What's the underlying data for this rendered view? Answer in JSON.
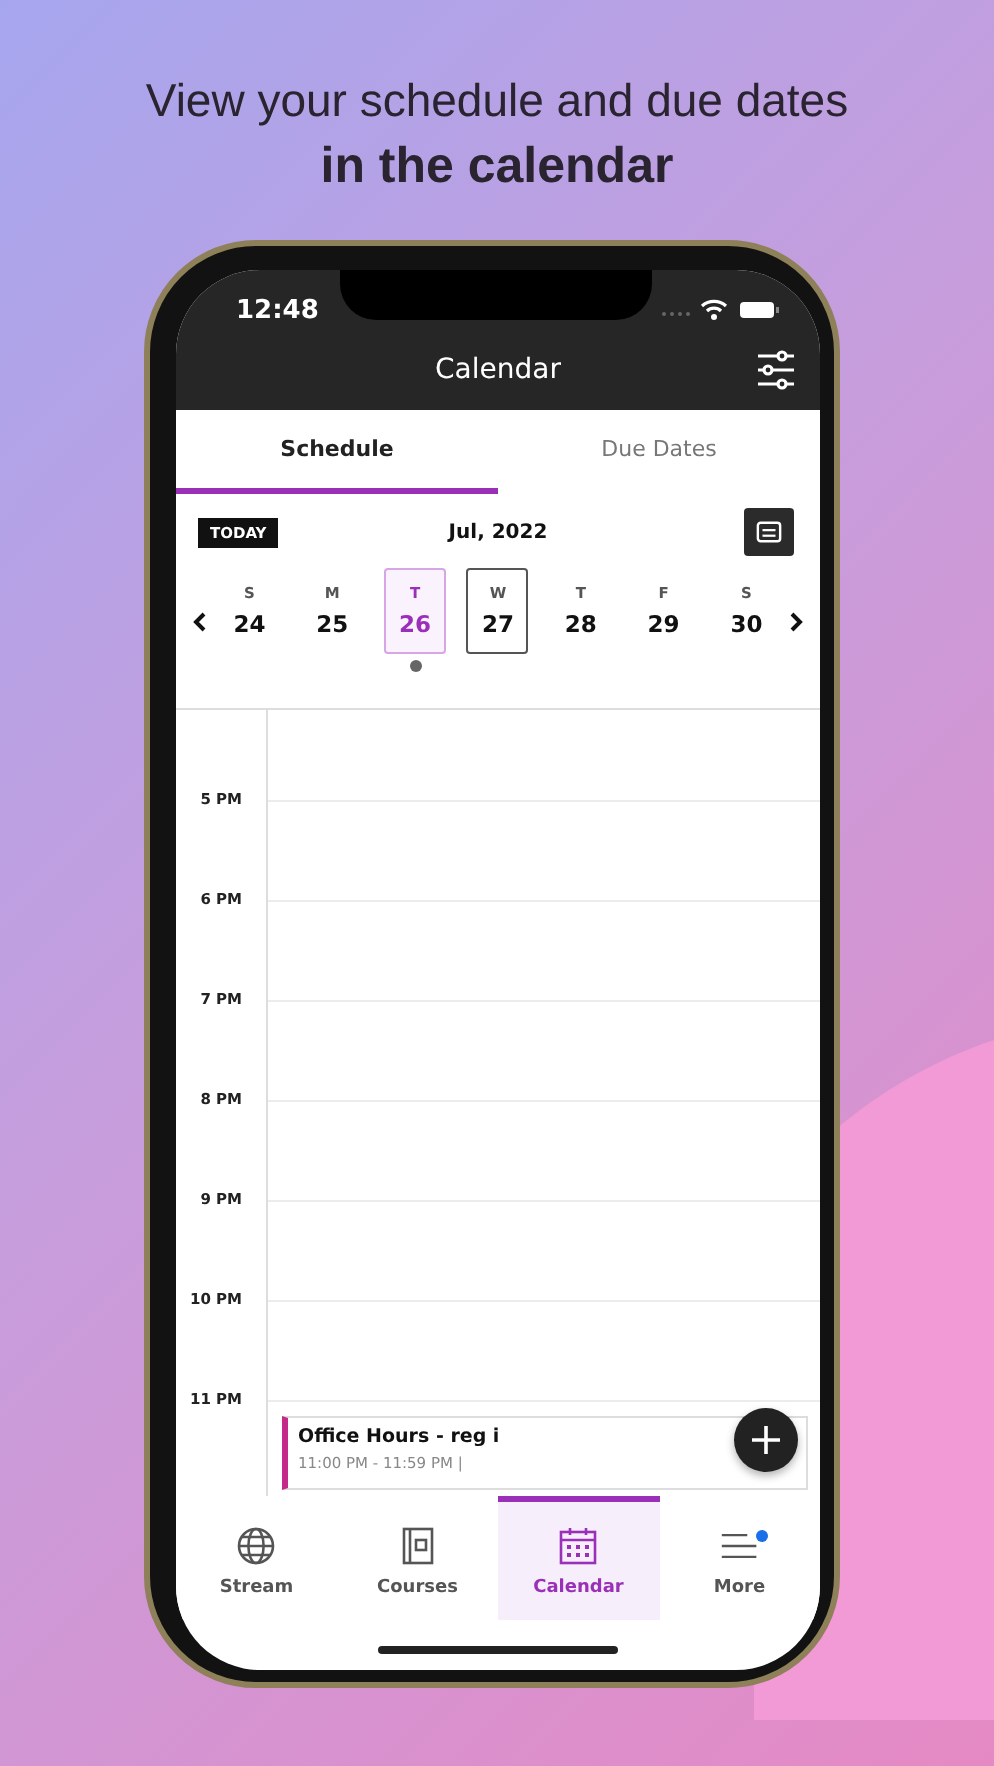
{
  "headline": {
    "line1": "View your schedule and due dates",
    "line2": "in the calendar"
  },
  "status_bar": {
    "time": "12:48"
  },
  "header": {
    "title": "Calendar"
  },
  "tabs": [
    {
      "label": "Schedule",
      "selected": true
    },
    {
      "label": "Due Dates",
      "selected": false
    }
  ],
  "date_strip": {
    "today_button": "TODAY",
    "month": "Jul, 2022",
    "days": [
      {
        "letter": "S",
        "number": "24",
        "selected": false,
        "outlined": false,
        "has_events": false
      },
      {
        "letter": "M",
        "number": "25",
        "selected": false,
        "outlined": false,
        "has_events": false
      },
      {
        "letter": "T",
        "number": "26",
        "selected": true,
        "outlined": false,
        "has_events": true
      },
      {
        "letter": "W",
        "number": "27",
        "selected": false,
        "outlined": true,
        "has_events": false
      },
      {
        "letter": "T",
        "number": "28",
        "selected": false,
        "outlined": false,
        "has_events": false
      },
      {
        "letter": "F",
        "number": "29",
        "selected": false,
        "outlined": false,
        "has_events": false
      },
      {
        "letter": "S",
        "number": "30",
        "selected": false,
        "outlined": false,
        "has_events": false
      }
    ]
  },
  "hours": [
    "5 PM",
    "6 PM",
    "7 PM",
    "8 PM",
    "9 PM",
    "10 PM",
    "11 PM"
  ],
  "event": {
    "title": "Office Hours - reg i",
    "time": "11:00 PM - 11:59 PM |",
    "color": "#c42a8a"
  },
  "nav": [
    {
      "label": "Stream",
      "kind": "globe",
      "selected": false,
      "badge": false
    },
    {
      "label": "Courses",
      "kind": "book",
      "selected": false,
      "badge": false
    },
    {
      "label": "Calendar",
      "kind": "calendar",
      "selected": true,
      "badge": false
    },
    {
      "label": "More",
      "kind": "menu",
      "selected": false,
      "badge": true
    }
  ]
}
